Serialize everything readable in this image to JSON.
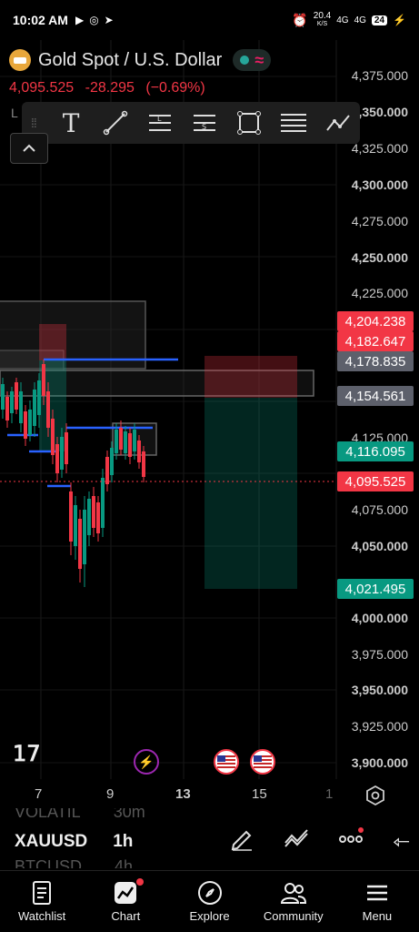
{
  "status_bar": {
    "time": "10:02 AM",
    "network_speed": "20.4",
    "network_unit": "K/S",
    "signal1": "4G",
    "signal2": "4G",
    "battery": "24"
  },
  "symbol": {
    "title": "Gold Spot / U.S. Dollar",
    "last_price": "4,095.525",
    "change": "-28.295",
    "change_pct": "(−0.69%)",
    "legend_abbrev": "L"
  },
  "price_axis": {
    "labels": [
      "4,375.000",
      "4,350.000",
      "4,325.000",
      "4,300.000",
      "4,275.000",
      "4,250.000",
      "4,225.000",
      "4,125.000",
      "4,075.000",
      "4,050.000",
      "4,000.000",
      "3,975.000",
      "3,950.000",
      "3,925.000",
      "3,900.000"
    ],
    "tags": [
      {
        "label": "4,204.238",
        "color": "#f23645"
      },
      {
        "label": "4,182.647",
        "color": "#f23645"
      },
      {
        "label": "4,178.835",
        "color": "#5d606b"
      },
      {
        "label": "4,154.561",
        "color": "#5d606b"
      },
      {
        "label": "4,116.095",
        "color": "#089981"
      },
      {
        "label": "4,095.525",
        "color": "#f23645"
      },
      {
        "label": "4,021.495",
        "color": "#089981"
      }
    ]
  },
  "time_axis": {
    "labels": [
      "7",
      "9",
      "13",
      "15",
      "1"
    ]
  },
  "bottom_panel": {
    "faded_top": "VOLATIL",
    "faded_top_val": "30m",
    "symbol": "XAUUSD",
    "interval": "1h",
    "faded_bottom": "BTCUSD",
    "faded_bottom_val": "4h"
  },
  "nav": {
    "watchlist": "Watchlist",
    "chart": "Chart",
    "explore": "Explore",
    "community": "Community",
    "menu": "Menu"
  },
  "colors": {
    "up": "#089981",
    "down": "#f23645",
    "accent_blue": "#2962ff"
  }
}
